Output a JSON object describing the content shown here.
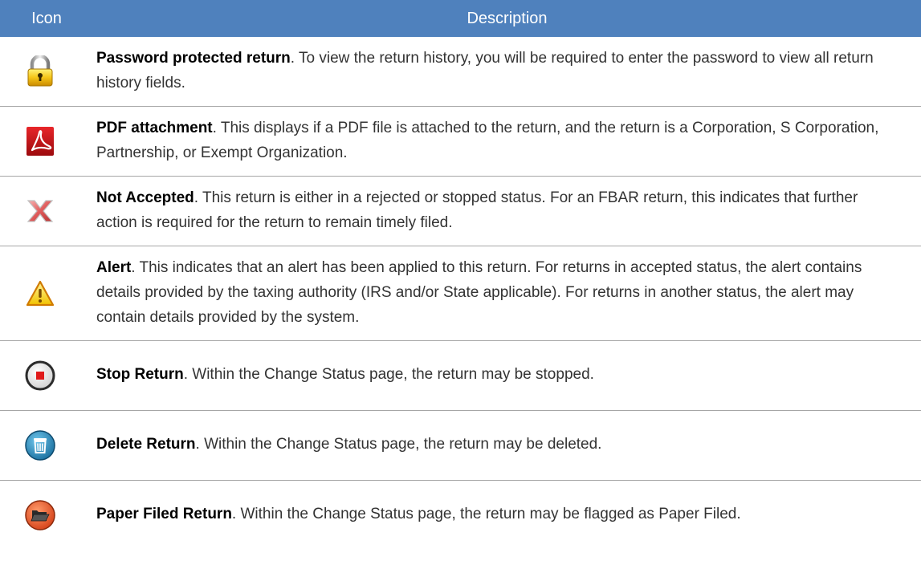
{
  "table": {
    "headers": {
      "icon": "Icon",
      "description": "Description"
    },
    "rows": [
      {
        "icon": "padlock-icon",
        "term": "Password protected return",
        "text": ". To view the return history, you will be required to enter the password to view all return history fields."
      },
      {
        "icon": "pdf-icon",
        "term": "PDF attachment",
        "text": ". This displays if a PDF file is attached to the return, and the return is a Corporation, S Corporation, Partnership, or Exempt Organization."
      },
      {
        "icon": "not-accepted-x-icon",
        "term": "Not Accepted",
        "text": ". This return is either in a rejected or stopped status. For an FBAR return, this indicates that further action is required for the return to remain timely filed."
      },
      {
        "icon": "alert-triangle-icon",
        "term": "Alert",
        "text": ". This indicates that an alert has been applied to this return. For returns in accepted status, the alert contains details provided by the taxing authority (IRS and/or State applicable). For returns in another status, the alert may contain details provided by the system."
      },
      {
        "icon": "stop-icon",
        "term": "Stop Return",
        "text": ". Within the Change Status page, the return may be stopped."
      },
      {
        "icon": "trash-icon",
        "term": "Delete Return",
        "text": ". Within the Change Status page, the return may be deleted."
      },
      {
        "icon": "folder-icon",
        "term": "Paper Filed Return",
        "text": ". Within the Change Status page, the return may be flagged as Paper Filed."
      }
    ]
  },
  "colors": {
    "header_bg": "#4f81bd",
    "header_text": "#ffffff",
    "row_divider": "#a6a6a6"
  }
}
